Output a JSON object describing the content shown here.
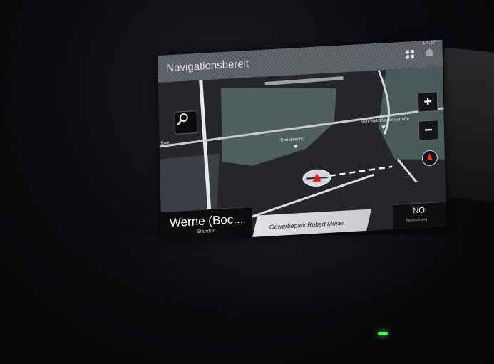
{
  "header": {
    "title": "Navigationsbereit",
    "time": "14:15"
  },
  "map": {
    "streets": [
      {
        "label": "Brandwacht"
      },
      {
        "label": "Von-Waldthausen-Straße"
      },
      {
        "label": "Bwe..."
      }
    ]
  },
  "controls": {
    "zoom_in": "+",
    "zoom_out": "−"
  },
  "location": {
    "name": "Werne (Boc...",
    "sub": "Standort"
  },
  "current_street": "Gewerbepark Robert Müser",
  "heading": {
    "value": "NO",
    "label": "Fahrtrichtung"
  },
  "colors": {
    "land": "#4f5f5d",
    "road": "#e7e9ec",
    "route": "#ffffff",
    "accent": "#e31d1d"
  }
}
